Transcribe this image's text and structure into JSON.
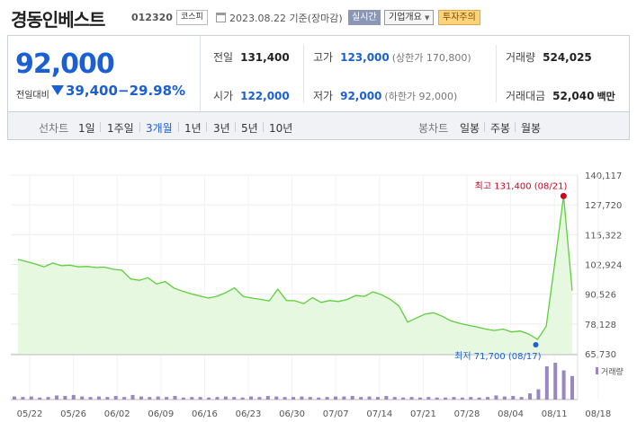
{
  "header": {
    "stock_name": "경동인베스트",
    "stock_code": "012320",
    "market": "코스피",
    "date": "2023.08.22 기준(장마감)",
    "realtime_label": "실시간",
    "company_label": "기업개요",
    "caution_label": "투자주의"
  },
  "quote": {
    "price": "92,000",
    "change_label": "전일대비",
    "change_value": "39,400",
    "change_pct": "−29.98%",
    "prev_close": {
      "label": "전일",
      "value": "131,400"
    },
    "high": {
      "label": "고가",
      "value": "123,000",
      "sub": "(상한가 170,800)"
    },
    "volume": {
      "label": "거래량",
      "value": "524,025"
    },
    "open": {
      "label": "시가",
      "value": "122,000"
    },
    "low": {
      "label": "저가",
      "value": "92,000",
      "sub": "(하한가 92,000)"
    },
    "trade_amount": {
      "label": "거래대금",
      "value": "52,040",
      "unit": "백만"
    }
  },
  "period_bar": {
    "line_label": "선차트",
    "line_options": [
      "1일",
      "1주일",
      "3개월",
      "1년",
      "3년",
      "5년",
      "10년"
    ],
    "line_selected": "3개월",
    "candle_label": "봉차트",
    "candle_options": [
      "일봉",
      "주봉",
      "월봉"
    ]
  },
  "colors": {
    "accent_blue": "#1a5fd4",
    "line_green": "#5ccf3a",
    "area_green": "#e6f8df",
    "volume_purple": "#9a86c3",
    "max_red": "#d0021b"
  },
  "chart_data": {
    "type": "area",
    "y_ticks": [
      "140,117",
      "127,720",
      "115,322",
      "102,924",
      "90,526",
      "78,128",
      "65,730"
    ],
    "ylim": [
      65730,
      140117
    ],
    "x_tick_labels": [
      "05/22",
      "05/26",
      "06/02",
      "06/09",
      "06/16",
      "06/23",
      "06/30",
      "07/07",
      "07/14",
      "07/21",
      "07/28",
      "08/04",
      "08/11",
      "08/18"
    ],
    "price_series": [
      105000,
      104100,
      103100,
      101900,
      103500,
      102400,
      102600,
      101900,
      102100,
      101600,
      101800,
      100900,
      100500,
      96900,
      96300,
      97400,
      94800,
      95800,
      93100,
      91800,
      90700,
      89800,
      88900,
      89700,
      91200,
      93200,
      89600,
      88900,
      88400,
      87700,
      92600,
      87900,
      87800,
      86600,
      89100,
      87100,
      87900,
      87500,
      88300,
      90000,
      89600,
      91500,
      90300,
      88400,
      85600,
      78900,
      80600,
      82300,
      82800,
      81300,
      79400,
      78400,
      77600,
      76900,
      76000,
      75400,
      76000,
      74800,
      75200,
      73900,
      71700,
      77200,
      104000,
      131400,
      92000
    ],
    "volume_series": [
      6,
      5,
      6,
      4,
      5,
      8,
      7,
      9,
      6,
      5,
      6,
      5,
      7,
      5,
      9,
      6,
      5,
      6,
      5,
      7,
      4,
      5,
      5,
      4,
      5,
      6,
      5,
      4,
      6,
      5,
      7,
      6,
      5,
      5,
      6,
      5,
      4,
      5,
      6,
      6,
      7,
      5,
      6,
      5,
      7,
      5,
      4,
      5,
      4,
      5,
      4,
      4,
      5,
      4,
      5,
      4,
      5,
      8,
      6,
      7,
      5,
      12,
      20,
      65,
      72,
      57,
      46
    ],
    "max_annotation": "최고 131,400 (08/21)",
    "min_annotation": "최저 71,700 (08/17)",
    "volume_legend": "거래량"
  }
}
